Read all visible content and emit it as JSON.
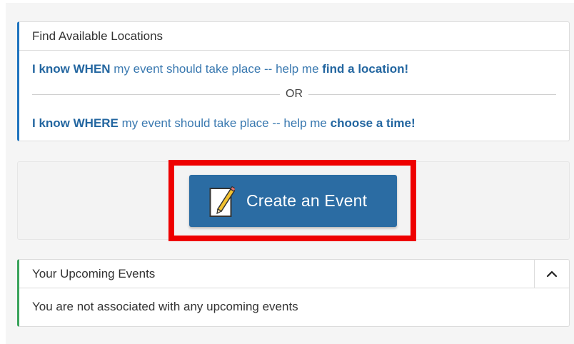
{
  "find_locations": {
    "title": "Find Available Locations",
    "when_line": {
      "strong": "I know WHEN",
      "middle": " my event should take place -- help me ",
      "link": "find a location!"
    },
    "or_label": "OR",
    "where_line": {
      "strong": "I know WHERE",
      "middle": " my event should take place -- help me ",
      "link": "choose a time!"
    }
  },
  "create_event": {
    "label": "Create an Event",
    "icon": "edit-document-icon"
  },
  "upcoming_events": {
    "title": "Your Upcoming Events",
    "collapse_icon": "chevron-up-icon",
    "empty_message": "You are not associated with any upcoming events"
  },
  "colors": {
    "brand_blue": "#2b6ca3",
    "link_blue": "#2366a0",
    "highlight_red": "#ee0000",
    "upcoming_accent_green": "#3aa35b"
  }
}
